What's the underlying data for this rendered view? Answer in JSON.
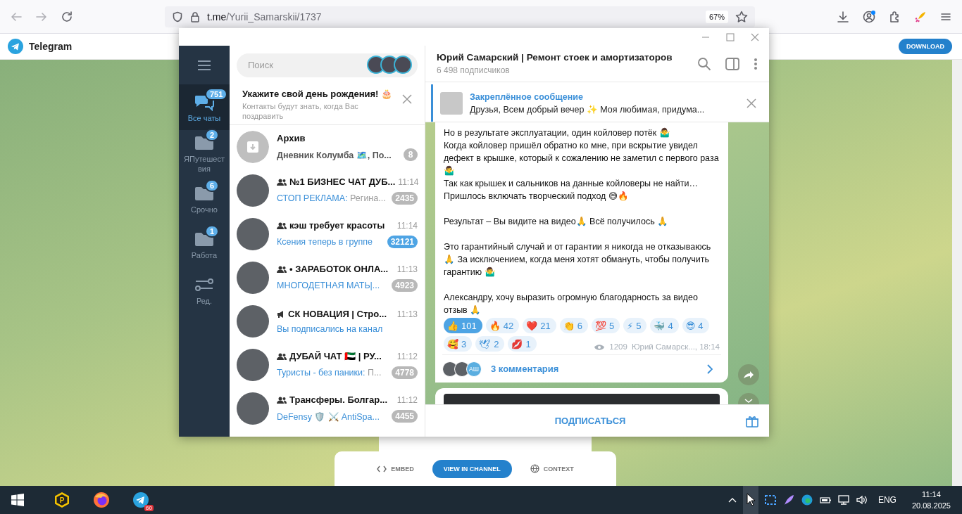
{
  "browser": {
    "url_host": "t.me",
    "url_path": "/Yurii_Samarskii/1737",
    "zoom": "67%"
  },
  "site": {
    "brand": "Telegram",
    "download": "DOWNLOAD",
    "actions": [
      {
        "kind": "embed",
        "label": "EMBED"
      },
      {
        "kind": "primary",
        "label": "VIEW IN CHANNEL"
      },
      {
        "kind": "context",
        "label": "CONTEXT"
      }
    ]
  },
  "telegram": {
    "folders": [
      {
        "kind": "all",
        "label": "Все чаты",
        "badge": "751",
        "selected": true
      },
      {
        "kind": "folder",
        "label": "ЯПутешествия",
        "badge": "2",
        "selected": false
      },
      {
        "kind": "folder",
        "label": "Срочно",
        "badge": "6",
        "selected": false
      },
      {
        "kind": "folder",
        "label": "Работа",
        "badge": "1",
        "selected": false
      },
      {
        "kind": "edit",
        "label": "Ред.",
        "selected": false
      }
    ],
    "search": {
      "placeholder": "Поиск"
    },
    "birthday": {
      "title": "Укажите свой день рождения! 🎂",
      "text": "Контакты будут знать, когда Вас поздравить"
    },
    "chats": [
      {
        "kind": "archive",
        "name": "Архив",
        "text": "Дневник Колумба 🗺️, По...",
        "badge": "8",
        "muted": true
      },
      {
        "kind": "group",
        "name": "№1 БИЗНЕС ЧАТ ДУБ...",
        "time": "11:14",
        "sender": "СТОП РЕКЛАМА:",
        "text": "Регина...",
        "badge": "2435",
        "muted": true
      },
      {
        "kind": "group",
        "name": "кэш требует красоты",
        "time": "11:14",
        "sender": "Ксения теперь в группе",
        "badge": "32121",
        "muted": false
      },
      {
        "kind": "group",
        "name": "• ЗАРАБОТОК ОНЛА...",
        "time": "11:13",
        "sender": "МНОГОДЕТНАЯ МАТЬ|...",
        "badge": "4923",
        "muted": true
      },
      {
        "kind": "channel",
        "name": "СК НОВАЦИЯ | Стро...",
        "time": "11:13",
        "sender": "Вы подписались на канал"
      },
      {
        "kind": "group",
        "name": "ДУБАЙ ЧАТ 🇦🇪 | РУ...",
        "time": "11:12",
        "sender": "Туристы - без паники:",
        "text": "П...",
        "badge": "4778",
        "muted": true
      },
      {
        "kind": "group",
        "name": "Трансферы. Болгар...",
        "time": "11:12",
        "sender": "DeFensy 🛡️ ⚔️ AntiSpa...",
        "badge": "4455",
        "muted": true
      }
    ],
    "channel": {
      "title": "Юрий Самарский | Ремонт стоек и амортизаторов",
      "subtitle": "6 498 подписчиков"
    },
    "pinned": {
      "label": "Закреплённое сообщение",
      "text": "Друзья, Всем добрый вечер ✨  Моя любимая, придума..."
    },
    "message": {
      "paragraphs": [
        "Но в результате эксплуатации, один койловер потёк 🤷‍♂️\nКогда койловер пришёл обратно ко мне, при вскрытие увидел дефект в крышке, который к сожалению не заметил с первого раза 🤷‍♂️\nТак как крышек и сальников на данные койловеры не найти…\nПришлось включать творческий подход 😅🔥",
        "Результат – Вы видите на видео🙏 Всё получилось 🙏",
        "Это гарантийный случай и от гарантии я никогда не отказываюсь 🙏 За исключением, когда меня хотят обмануть, чтобы получить гарантию 🤷‍♂️",
        "Александру, хочу выразить огромную благодарность за видео отзыв 🙏"
      ],
      "reactions": [
        {
          "emoji": "👍",
          "count": "101",
          "selected": true
        },
        {
          "emoji": "🔥",
          "count": "42",
          "selected": false
        },
        {
          "emoji": "❤️",
          "count": "21",
          "selected": false
        },
        {
          "emoji": "👏",
          "count": "6",
          "selected": false
        },
        {
          "emoji": "💯",
          "count": "5",
          "selected": false
        },
        {
          "emoji": "⚡",
          "count": "5",
          "selected": false
        },
        {
          "emoji": "🐳",
          "count": "4",
          "selected": false
        },
        {
          "emoji": "😎",
          "count": "4",
          "selected": false
        },
        {
          "emoji": "🥰",
          "count": "3",
          "selected": false
        },
        {
          "emoji": "🕊",
          "count": "2",
          "selected": false
        },
        {
          "emoji": "💋",
          "count": "1",
          "selected": false
        }
      ],
      "views": "1209",
      "signature": "Юрий Самарск..., 18:14",
      "comment_avatars": [
        {
          "kind": "photo"
        },
        {
          "kind": "photo"
        },
        {
          "kind": "initials",
          "text": "АШ"
        }
      ],
      "comments": "3 комментария"
    },
    "subscribe": "ПОДПИСАТЬСЯ"
  },
  "taskbar": {
    "apps": [
      {
        "kind": "p",
        "label": "P"
      },
      {
        "kind": "firefox"
      },
      {
        "kind": "telegram",
        "badge": "60"
      }
    ],
    "language": "ENG",
    "time": "11:14",
    "date": "20.08.2025"
  }
}
